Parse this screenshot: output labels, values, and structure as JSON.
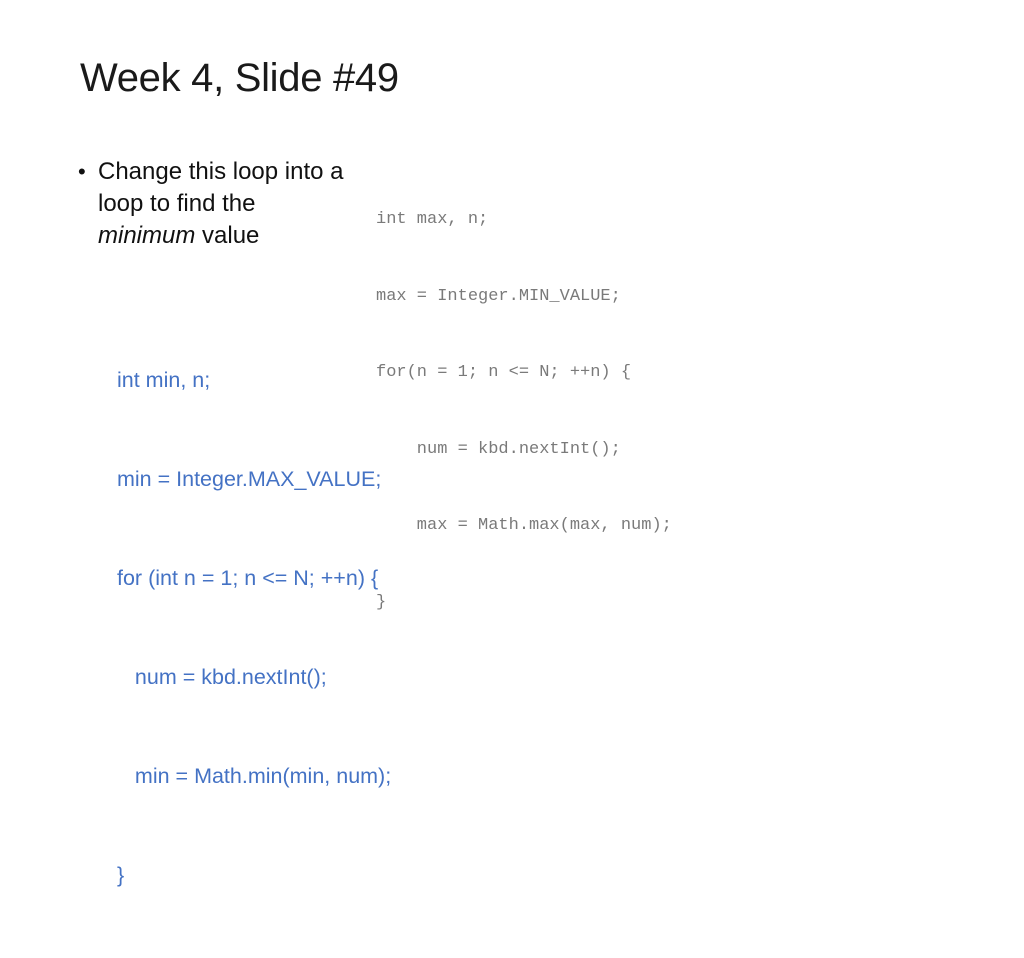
{
  "slide": {
    "title": "Week 4, Slide #49",
    "bullet": {
      "symbol": "•",
      "text_before": "Change this loop into a loop to find the ",
      "emphasis": "minimum",
      "text_after": " value"
    },
    "original_code": [
      "int max, n;",
      "max = Integer.MIN_VALUE;",
      "for(n = 1; n <= N; ++n) {",
      "    num = kbd.nextInt();",
      "    max = Math.max(max, num);",
      "}"
    ],
    "answer_code": [
      "int min, n;",
      "min = Integer.MAX_VALUE;",
      "for (int n = 1; n <= N; ++n) {",
      "   num = kbd.nextInt();",
      "   min = Math.min(min, num);",
      "}"
    ],
    "colors": {
      "title": "#1a1a1a",
      "body_text": "#111111",
      "original_code": "#7a7a7a",
      "answer_code": "#4472c4"
    }
  }
}
